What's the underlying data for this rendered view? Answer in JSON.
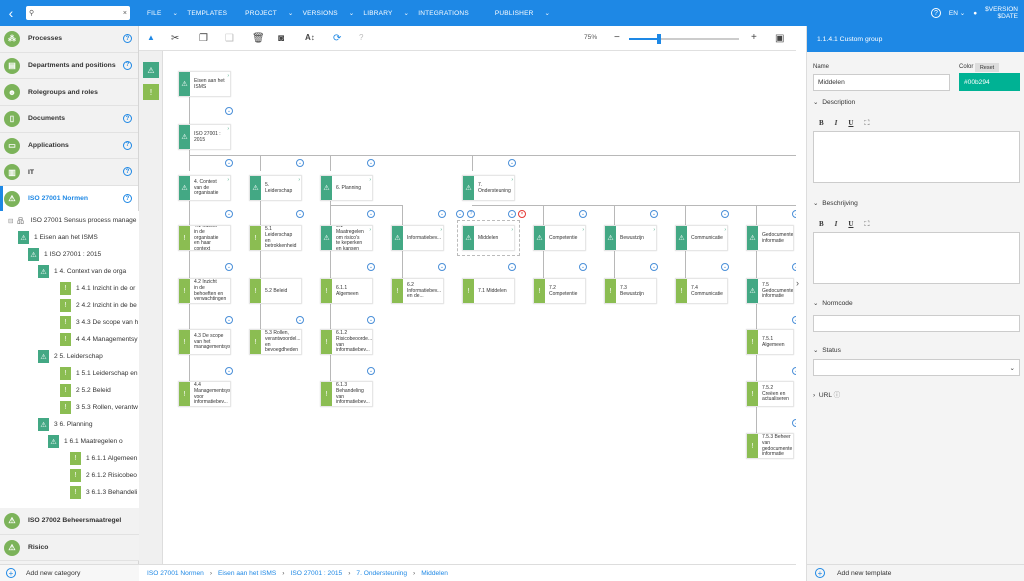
{
  "topbar": {
    "search_value": "",
    "menus": [
      "FILE",
      "TEMPLATES",
      "PROJECT",
      "VERSIONS",
      "LIBRARY",
      "INTEGRATIONS",
      "PUBLISHER"
    ],
    "lang": "EN",
    "version": "$VERSION",
    "date": "$DATE"
  },
  "sidebar": {
    "categories": [
      {
        "label": "Processes"
      },
      {
        "label": "Departments and positions"
      },
      {
        "label": "Rolegroups and roles"
      },
      {
        "label": "Documents"
      },
      {
        "label": "Applications"
      },
      {
        "label": "IT"
      },
      {
        "label": "ISO 27001 Normen",
        "active": true
      }
    ],
    "tree": [
      "ISO 27001 Sensus process manage",
      "1 Eisen aan het ISMS",
      "1 ISO 27001 : 2015",
      "1 4. Context van de orga",
      "1 4.1 Inzicht in de or",
      "2 4.2 Inzicht in de be",
      "3 4.3 De scope van h",
      "4 4.4 Managementsy",
      "2 5. Leiderschap",
      "1 5.1 Leiderschap en",
      "2 5.2 Beleid",
      "3 5.3 Rollen, verantw",
      "3 6. Planning",
      "1 6.1 Maatregelen o",
      "1 6.1.1 Algemeen",
      "2 6.1.2 Risicobeo",
      "3 6.1.3 Behandeli"
    ],
    "categories_bottom": [
      {
        "label": "ISO 27002 Beheersmaatregel"
      },
      {
        "label": "Risico"
      }
    ],
    "add_category": "Add new category"
  },
  "toolbar": {
    "zoom": "75%",
    "zoom_level": 0.27
  },
  "canvas": {
    "nodes": [
      "Eisen aan het\nISMS",
      "ISO 27001 :\n2015",
      "4. Context\nvan de\norganisatie",
      "5.\nLeiderschap",
      "6. Planning",
      "7.\nOndersteuning",
      "4.1 Inzicht\nin de\norganisatie\nen haar\ncontext",
      "5.1\nLeiderschap\nen\nbetrokkenheid",
      "6.1\nMaatregelen\nom risico's\nte keperken\nen kansen",
      "Informatiebev...",
      "Middelen",
      "Competentie",
      "Bewustzijn",
      "Communicatie",
      "Gedocumente\ninformatie",
      "4.2 Inzicht\nin de\nbehoeften en\nverwachtingen",
      "5.2 Beleid",
      "6.1.1\nAlgemeen",
      "6.2\nInformatiebev...\nen de...",
      "7.1 Middelen",
      "7.2\nCompetentie",
      "7.3\nBewustzijn",
      "7.4\nCommunicatie",
      "7.5\nGedocumente\ninformatie",
      "4.3 De scope\nvan het\nmanagementsys...",
      "5.3 Rollen,\nverantwoordel...\nen\nbevoegdheden",
      "6.1.2\nRisicobeoorde...\nvan\ninformatiebev...",
      "7.5.1\nAlgemeen",
      "4.4\nManagementsys...\nvoor\ninformatiebev...",
      "6.1.3\nBehandeling\nvan\ninformatiebev...",
      "7.5.2\nCreëen en\nactualiseren",
      "7.5.3 Beheer\nvan\ngedocumente\ninformatie"
    ]
  },
  "breadcrumb": [
    "ISO 27001 Normen",
    "Eisen aan het ISMS",
    "ISO 27001 : 2015",
    "7. Ondersteuning",
    "Middelen"
  ],
  "panel": {
    "header": "1.1.4.1 Custom group",
    "name_label": "Name",
    "name_value": "Middelen",
    "color_label": "Color",
    "reset_label": "Reset",
    "color_value": "#00b294",
    "description_label": "Description",
    "beschrijving_label": "Beschrijving",
    "normcode_label": "Normcode",
    "status_label": "Status",
    "url_label": "URL",
    "add_template": "Add new template"
  },
  "colors": {
    "accent": "#1e88e5",
    "group": "#43a884",
    "leaf": "#8bbd52",
    "selected_color": "#00b294"
  }
}
